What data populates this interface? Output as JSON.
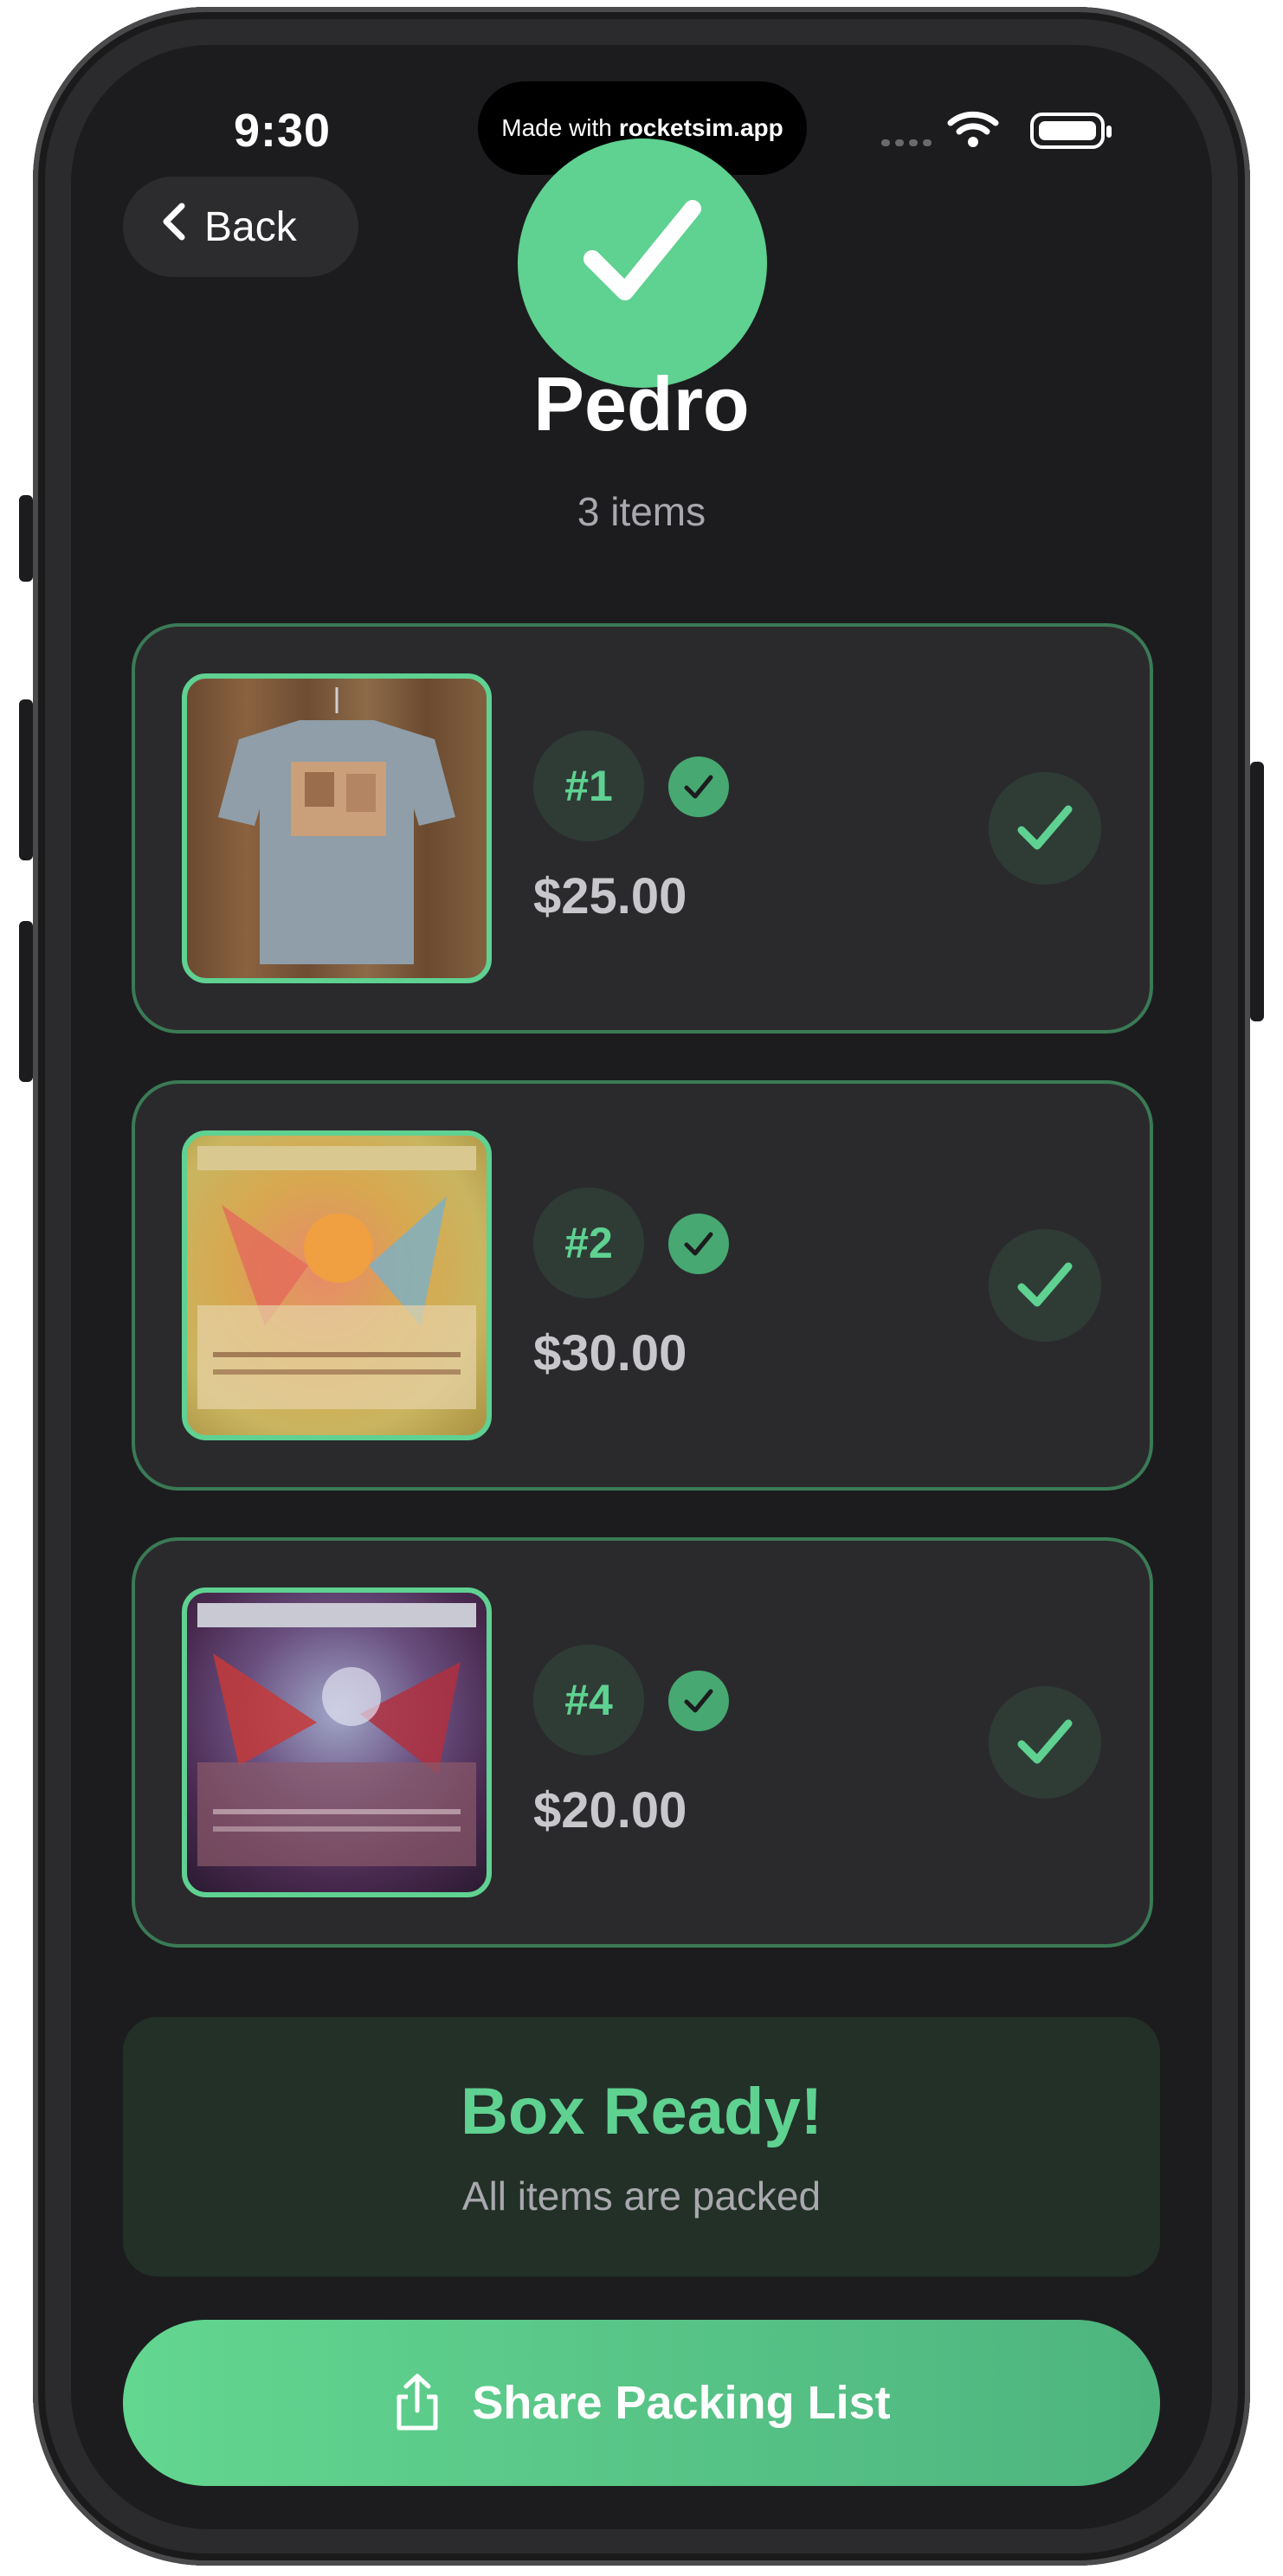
{
  "status_bar": {
    "time": "9:30",
    "island_prefix": "Made with",
    "island_brand": "rocketsim.app"
  },
  "nav": {
    "back_label": "Back"
  },
  "header": {
    "name": "Pedro",
    "item_count": "3 items"
  },
  "items": [
    {
      "number": "#1",
      "price": "$25.00",
      "thumbnail": "t-shirt photo",
      "packed": true
    },
    {
      "number": "#2",
      "price": "$30.00",
      "thumbnail": "gold trading card",
      "packed": true
    },
    {
      "number": "#4",
      "price": "$20.00",
      "thumbnail": "dark trading card",
      "packed": true
    }
  ],
  "box_status": {
    "title": "Box Ready!",
    "subtitle": "All items are packed"
  },
  "share_button": {
    "label": "Share Packing List",
    "icon": "share-icon"
  },
  "colors": {
    "accent": "#5fd191",
    "background": "#1c1c1e",
    "card": "#2a2a2d",
    "card_border": "#3a7a55"
  }
}
